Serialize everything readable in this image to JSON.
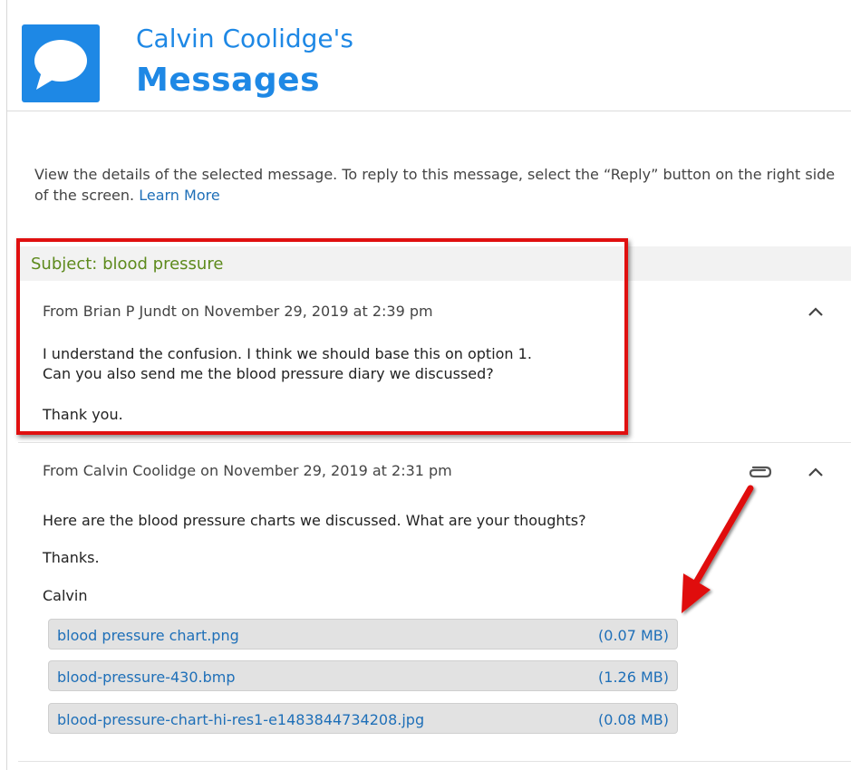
{
  "header": {
    "owner": "Calvin Coolidge's",
    "title": "Messages",
    "logo_icon": "speech-bubble-icon",
    "accent": "#1e88e5"
  },
  "intro": {
    "text": "View the details of the selected message. To reply to this message, select the “Reply” button on the right side of the screen.",
    "link": "Learn More"
  },
  "subject": "Subject: blood pressure",
  "messages": [
    {
      "meta": "From Brian P Jundt on November 29, 2019 at 2:39 pm",
      "body_line1": "I understand the confusion.  I think we should base this on option 1.",
      "body_line2": "Can you also send me the blood pressure diary we discussed?",
      "body_line3": "Thank you."
    },
    {
      "meta": "From Calvin Coolidge on November 29, 2019 at 2:31 pm",
      "body_line1": "Here are the blood pressure charts we discussed.  What are your thoughts?",
      "body_line2": "Thanks.",
      "body_line3": "Calvin",
      "attachments": [
        {
          "name": "blood pressure chart.png",
          "size": "(0.07 MB)"
        },
        {
          "name": "blood-pressure-430.bmp",
          "size": "(1.26 MB)"
        },
        {
          "name": "blood-pressure-chart-hi-res1-e1483844734208.jpg",
          "size": "(0.08 MB)"
        }
      ]
    }
  ],
  "annotation_colors": {
    "highlight": "#e01010"
  },
  "icons": {
    "collapse": "chevron-up-icon",
    "attachment": "paperclip-icon",
    "arrow": "red-arrow-icon"
  }
}
